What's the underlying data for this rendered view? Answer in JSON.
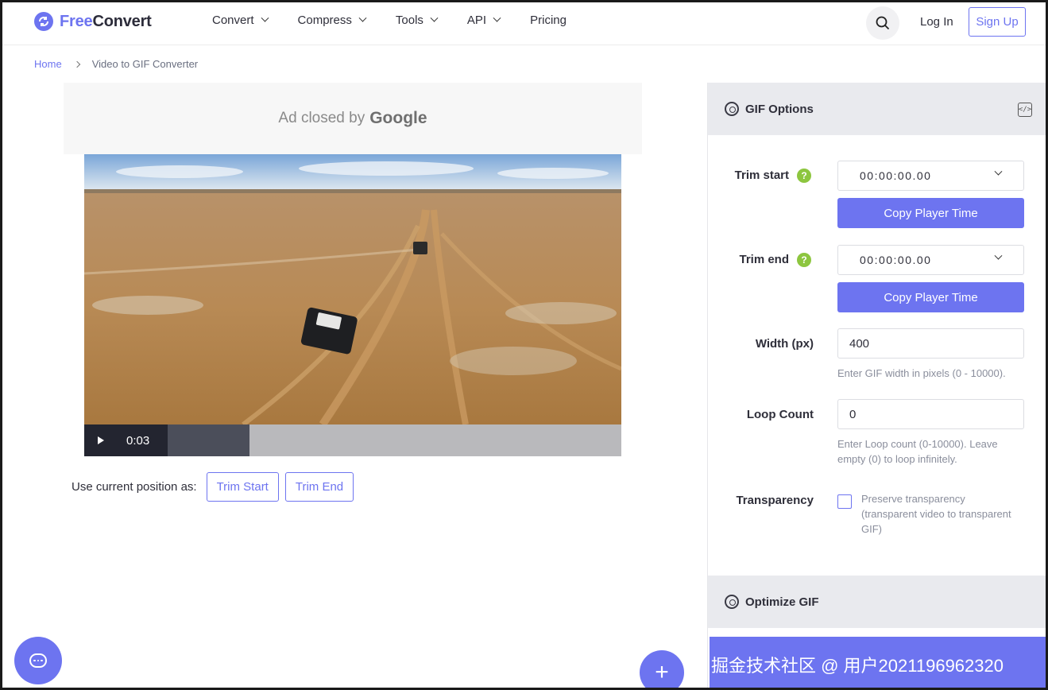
{
  "brand": {
    "free": "Free",
    "convert": "Convert",
    "accent": "#6d74f0"
  },
  "nav": {
    "items": [
      {
        "label": "Convert",
        "dropdown": true
      },
      {
        "label": "Compress",
        "dropdown": true
      },
      {
        "label": "Tools",
        "dropdown": true
      },
      {
        "label": "API",
        "dropdown": true
      },
      {
        "label": "Pricing",
        "dropdown": false
      }
    ],
    "login": "Log In",
    "signup": "Sign Up"
  },
  "breadcrumb": {
    "home": "Home",
    "current": "Video to GIF Converter"
  },
  "ad": {
    "prefix": "Ad closed by",
    "brand": "Google"
  },
  "player": {
    "time": "0:03",
    "progress": 0.18
  },
  "use_position": {
    "label": "Use current position as:",
    "trim_start": "Trim Start",
    "trim_end": "Trim End"
  },
  "gif_options": {
    "title": "GIF Options",
    "trim_start": {
      "label": "Trim start",
      "help": "?",
      "value": "00:00:00.00",
      "copy": "Copy Player Time"
    },
    "trim_end": {
      "label": "Trim end",
      "help": "?",
      "value": "00:00:00.00",
      "copy": "Copy Player Time"
    },
    "width": {
      "label": "Width (px)",
      "value": "400",
      "hint": "Enter GIF width in pixels (0 - 10000)."
    },
    "loop": {
      "label": "Loop Count",
      "value": "0",
      "hint": "Enter Loop count (0-10000). Leave empty (0) to loop infinitely."
    },
    "transparency": {
      "label": "Transparency",
      "checkbox": "Preserve transparency (transparent video to transparent GIF)",
      "checked": false
    }
  },
  "optimize": {
    "title": "Optimize GIF"
  },
  "bottom_bar": {
    "text": "掘金技术社区 @ 用户2021196962320"
  }
}
